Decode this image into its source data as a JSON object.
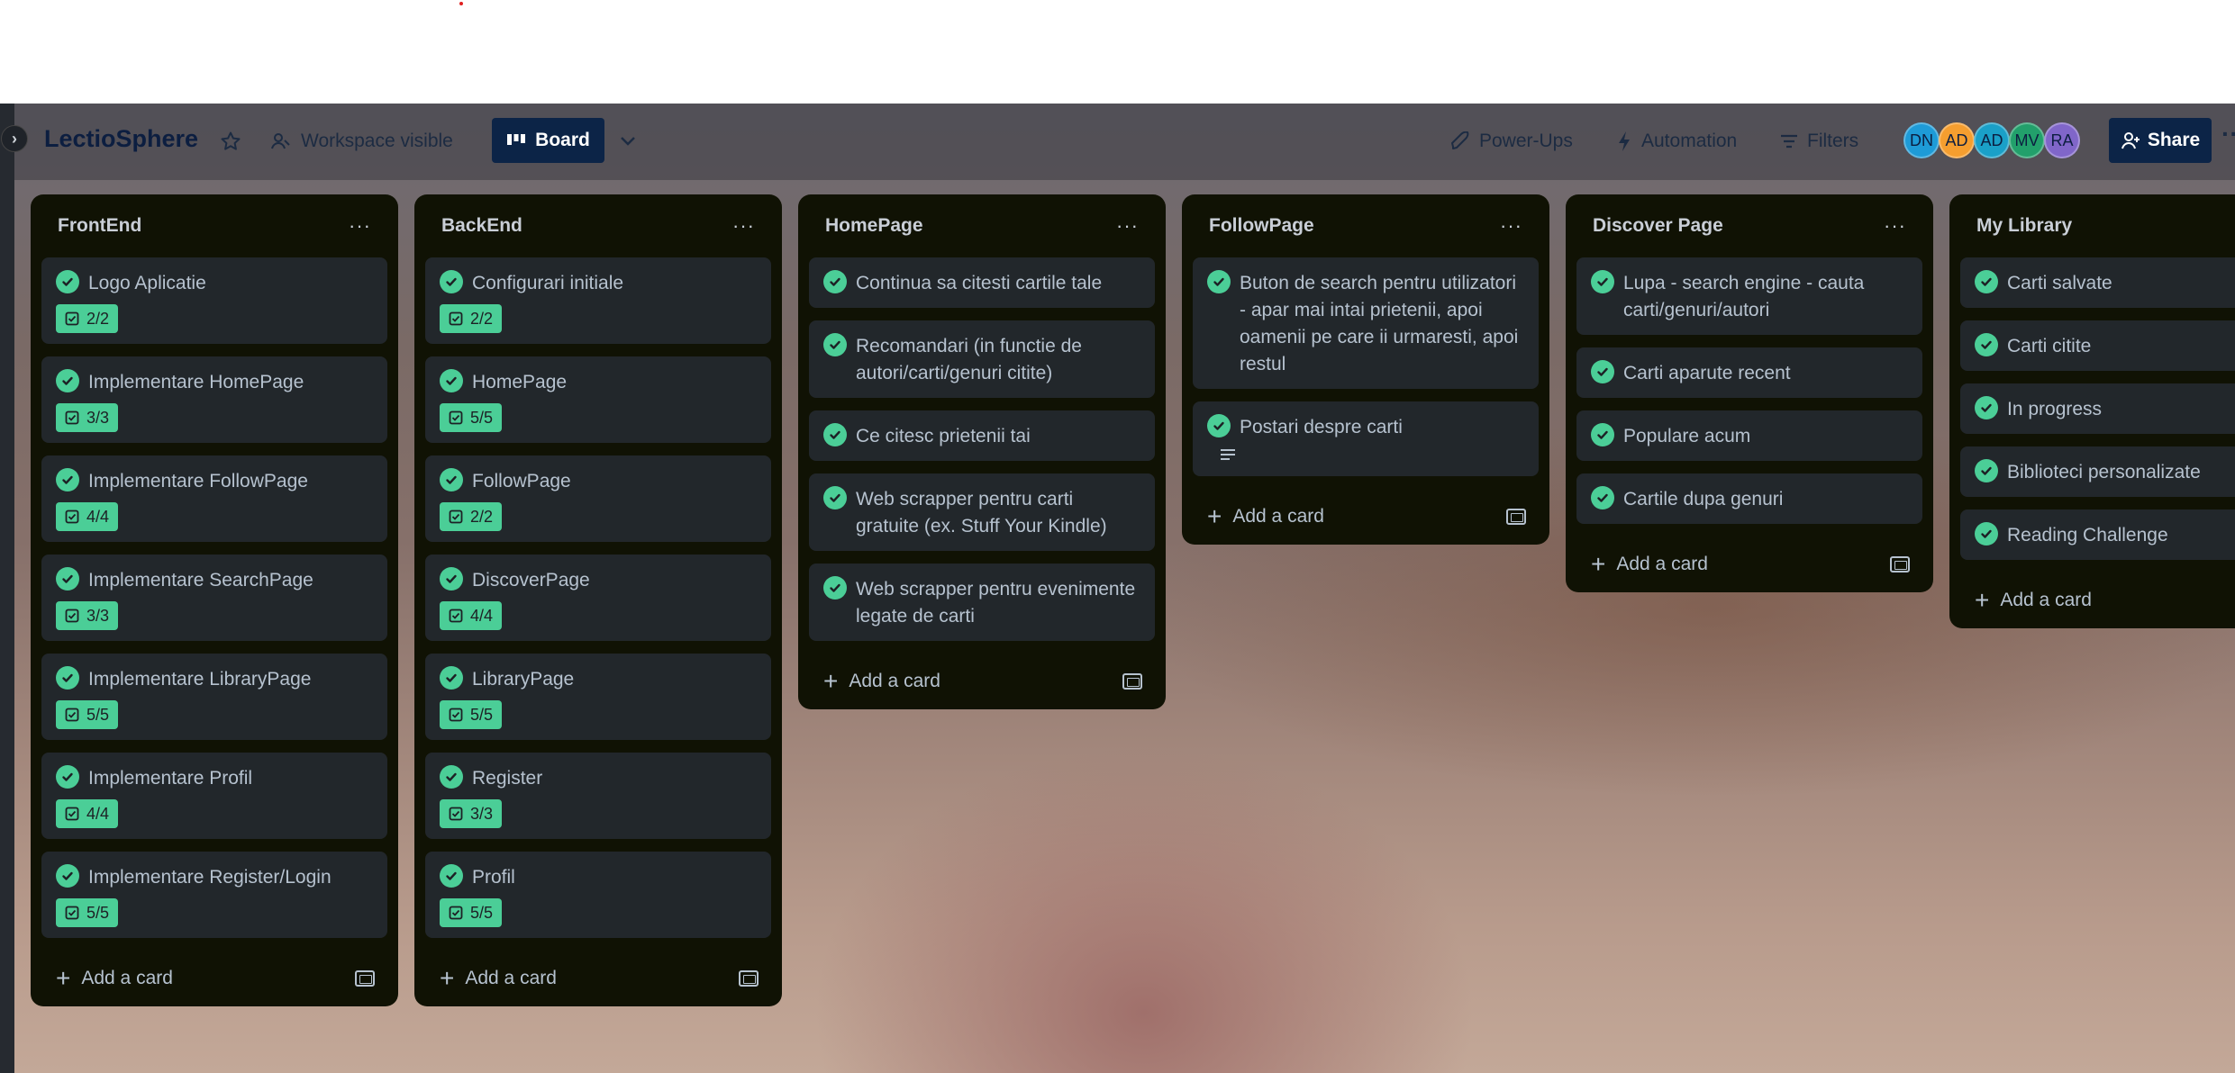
{
  "board": {
    "title": "LectioSphere",
    "visibility": "Workspace visible",
    "view": "Board",
    "power_ups": "Power-Ups",
    "automation": "Automation",
    "filters": "Filters",
    "share": "Share",
    "members": [
      {
        "initials": "DN",
        "color": "#1e9bd7"
      },
      {
        "initials": "AD",
        "color": "#f59e2f"
      },
      {
        "initials": "AD",
        "color": "#1aa0c8"
      },
      {
        "initials": "MV",
        "color": "#22a06b"
      },
      {
        "initials": "RA",
        "color": "#8066c9"
      }
    ]
  },
  "add_card_label": "Add a card",
  "lists": [
    {
      "title": "FrontEnd",
      "cards": [
        {
          "text": "Logo Aplicatie",
          "badge": "2/2"
        },
        {
          "text": "Implementare HomePage",
          "badge": "3/3"
        },
        {
          "text": "Implementare FollowPage",
          "badge": "4/4"
        },
        {
          "text": "Implementare SearchPage",
          "badge": "3/3"
        },
        {
          "text": "Implementare LibraryPage",
          "badge": "5/5"
        },
        {
          "text": "Implementare Profil",
          "badge": "4/4"
        },
        {
          "text": "Implementare Register/Login",
          "badge": "5/5"
        }
      ]
    },
    {
      "title": "BackEnd",
      "cards": [
        {
          "text": "Configurari initiale",
          "badge": "2/2"
        },
        {
          "text": "HomePage",
          "badge": "5/5"
        },
        {
          "text": "FollowPage",
          "badge": "2/2"
        },
        {
          "text": "DiscoverPage",
          "badge": "4/4"
        },
        {
          "text": "LibraryPage",
          "badge": "5/5"
        },
        {
          "text": "Register",
          "badge": "3/3"
        },
        {
          "text": "Profil",
          "badge": "5/5"
        }
      ]
    },
    {
      "title": "HomePage",
      "cards": [
        {
          "text": "Continua sa citesti cartile tale"
        },
        {
          "text": "Recomandari (in functie de autori/carti/genuri citite)"
        },
        {
          "text": "Ce citesc prietenii tai"
        },
        {
          "text": "Web scrapper pentru carti gratuite (ex. Stuff Your Kindle)"
        },
        {
          "text": "Web scrapper pentru evenimente legate de carti"
        }
      ]
    },
    {
      "title": "FollowPage",
      "cards": [
        {
          "text": "Buton de search pentru utilizatori - apar mai intai prietenii, apoi oamenii pe care ii urmaresti, apoi restul"
        },
        {
          "text": "Postari despre carti",
          "description": true
        }
      ]
    },
    {
      "title": "Discover Page",
      "cards": [
        {
          "text": "Lupa - search engine - cauta carti/genuri/autori"
        },
        {
          "text": "Carti aparute recent"
        },
        {
          "text": "Populare acum"
        },
        {
          "text": "Cartile dupa genuri"
        }
      ]
    },
    {
      "title": "My Library",
      "cards": [
        {
          "text": "Carti salvate"
        },
        {
          "text": "Carti citite"
        },
        {
          "text": "In progress"
        },
        {
          "text": "Biblioteci personalizate"
        },
        {
          "text": "Reading Challenge"
        }
      ]
    }
  ]
}
